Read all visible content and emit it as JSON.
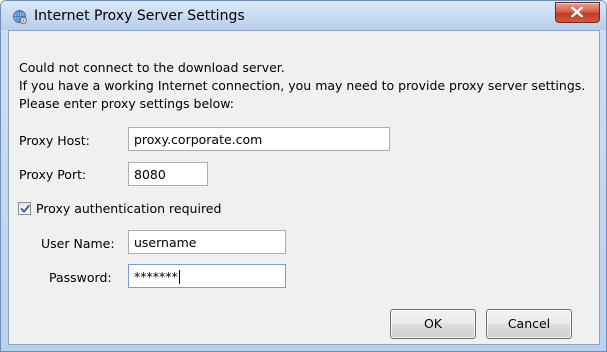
{
  "window": {
    "title": "Internet Proxy Server Settings"
  },
  "message": {
    "line1": "Could not connect to the download server.",
    "line2": "If you have a working Internet connection, you may need to provide proxy server settings.",
    "line3": "Please enter proxy settings below:"
  },
  "proxy": {
    "host_label": "Proxy Host:",
    "host_value": "proxy.corporate.com",
    "port_label": "Proxy Port:",
    "port_value": "8080"
  },
  "auth": {
    "checkbox_label": "Proxy authentication required",
    "checked": true,
    "username_label": "User Name:",
    "username_value": "username",
    "password_label": "Password:",
    "password_value": "*******"
  },
  "buttons": {
    "ok_label": "OK",
    "cancel_label": "Cancel"
  },
  "colors": {
    "titlebar": "#c7dbf2",
    "client_background": "#f0f0f0",
    "close_button": "#c23a22",
    "check_mark": "#3c5a8c"
  },
  "icons": {
    "title_icon": "globe-gear-icon",
    "close_icon": "close-x-icon",
    "checkbox_mark": "check-icon"
  }
}
